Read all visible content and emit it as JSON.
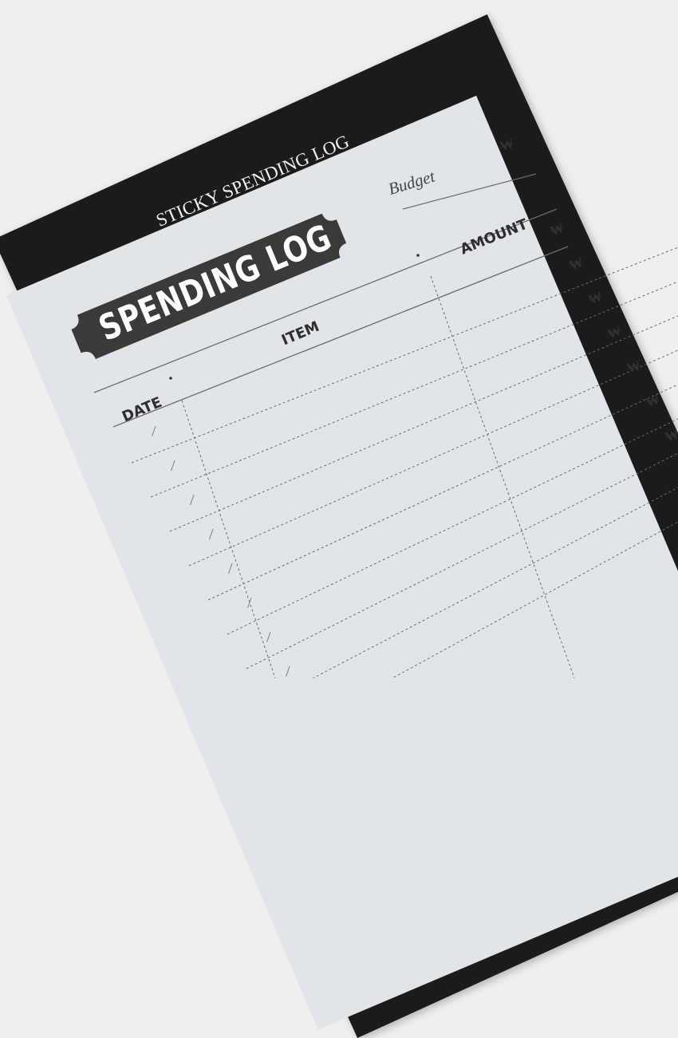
{
  "pad": {
    "brand": "STICKY SPENDING LOG",
    "title": "SPENDING LOG",
    "budget_label": "Budget",
    "currency_symbol": "₩",
    "columns": {
      "date": "DATE",
      "item": "ITEM",
      "amount": "AMOUNT"
    },
    "date_separator": "/"
  },
  "colors": {
    "backing": "#1b1b1b",
    "paper": "#e1e4e8",
    "title_plate": "#3a3b39",
    "lines": "#6b6b6b"
  }
}
